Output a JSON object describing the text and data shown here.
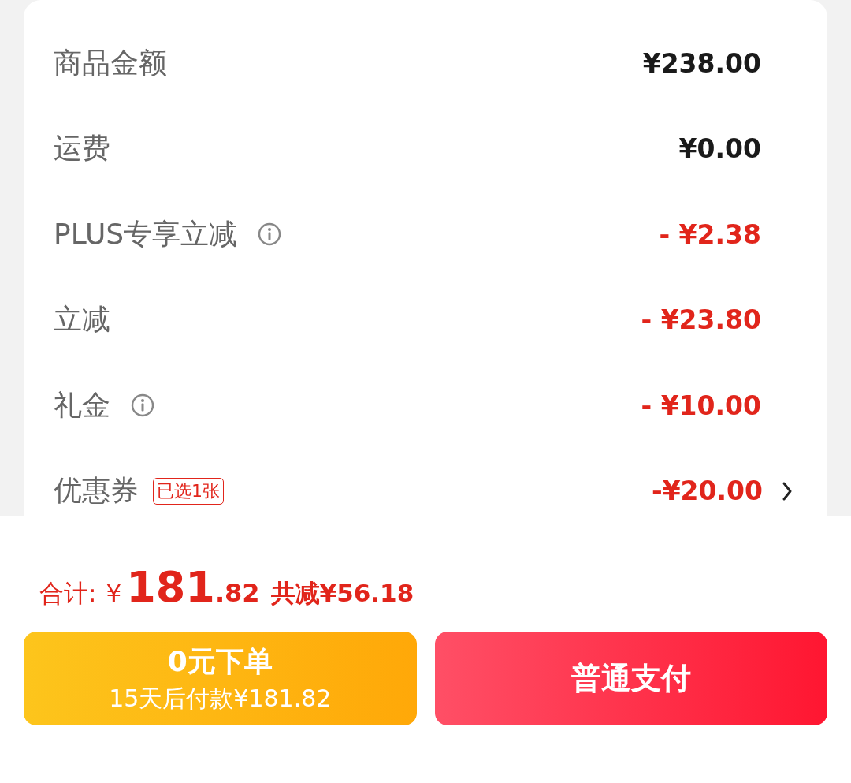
{
  "rows": [
    {
      "label": "商品金额",
      "value": "¥238.00",
      "kind": "amount",
      "info": false,
      "chevron": false
    },
    {
      "label": "运费",
      "value": "¥0.00",
      "kind": "amount",
      "info": false,
      "chevron": false
    },
    {
      "label": "PLUS专享立减",
      "value": "- ¥2.38",
      "kind": "discount",
      "info": true,
      "chevron": false
    },
    {
      "label": "立减",
      "value": "- ¥23.80",
      "kind": "discount",
      "info": false,
      "chevron": false
    },
    {
      "label": "礼金",
      "value": "- ¥10.00",
      "kind": "discount",
      "info": true,
      "chevron": false
    },
    {
      "label": "优惠券",
      "tag": "已选1张",
      "value": "-¥20.00",
      "kind": "discount",
      "info": false,
      "chevron": true
    }
  ],
  "total": {
    "label": "合计:",
    "currency": "¥",
    "integer": "181",
    "decimal": ".82",
    "saved": "共减¥56.18"
  },
  "buttons": [
    {
      "kind": "later",
      "title": "0元下单",
      "subtitle": "15天后付款¥181.82"
    },
    {
      "kind": "pay",
      "title": "普通支付"
    }
  ]
}
